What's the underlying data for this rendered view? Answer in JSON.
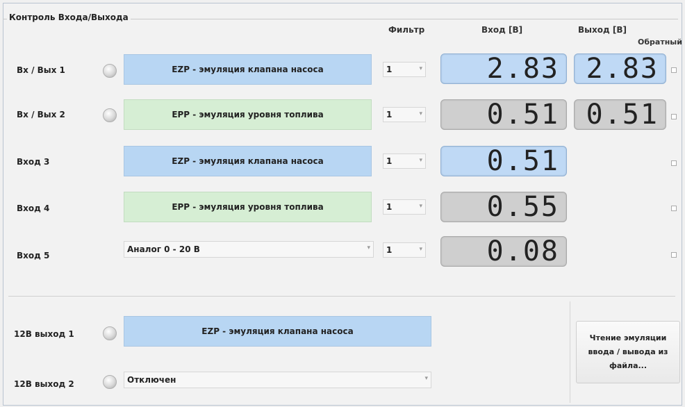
{
  "group_title": "Контроль Входа/Выхода",
  "headers": {
    "filter": "Фильтр",
    "input": "Вход [В]",
    "output": "Выход [В]",
    "inverse": "Обратный"
  },
  "rows": [
    {
      "label": "Вх / Вых 1",
      "mode": "EZP - эмуляция клапана насоса",
      "filter": "1",
      "input": "2.83",
      "output": "2.83"
    },
    {
      "label": "Вх / Вых 2",
      "mode": "EPP - эмуляция уровня топлива",
      "filter": "1",
      "input": "0.51",
      "output": "0.51"
    },
    {
      "label": "Вход 3",
      "mode": "EZP - эмуляция клапана насоса",
      "filter": "1",
      "input": "0.51"
    },
    {
      "label": "Вход 4",
      "mode": "EPP - эмуляция уровня топлива",
      "filter": "1",
      "input": "0.55"
    },
    {
      "label": "Вход 5",
      "mode": "Аналог 0 - 20 В",
      "filter": "1",
      "input": "0.08"
    }
  ],
  "outputs_12v": [
    {
      "label": "12В выход 1",
      "mode": "EZP - эмуляция клапана насоса"
    },
    {
      "label": "12В выход 2",
      "mode": "Отключен"
    }
  ],
  "file_button": "Чтение эмуляции ввода / вывода из файла...",
  "colors": {
    "ezp_blue": "#b8d6f3",
    "epp_green": "#d6eed4",
    "display_grey": "#cfcfcf"
  },
  "icons": {
    "led": "status-led-icon",
    "dropdown": "chevron-down-icon",
    "checkbox": "checkbox-unchecked"
  }
}
